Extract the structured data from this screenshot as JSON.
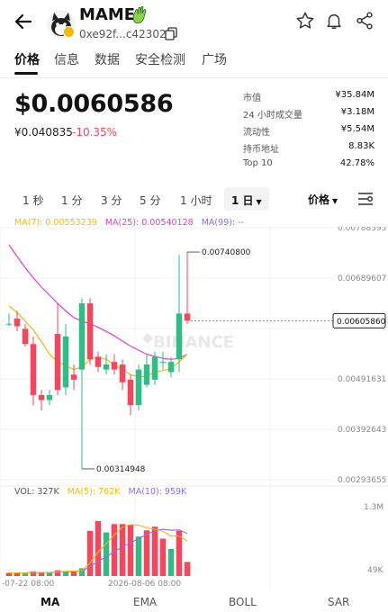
{
  "header": {
    "token_name": "MAME",
    "address": "0xe92f...c42302",
    "icons": [
      "back-arrow-icon",
      "avatar",
      "wave-emoji-icon",
      "copy-icon",
      "star-icon",
      "bell-icon",
      "share-icon"
    ]
  },
  "tabs": [
    {
      "label": "价格",
      "active": true
    },
    {
      "label": "信息",
      "active": false
    },
    {
      "label": "数据",
      "active": false
    },
    {
      "label": "安全检测",
      "active": false
    },
    {
      "label": "广场",
      "active": false
    }
  ],
  "price": {
    "main": "$0.0060586",
    "secondary": "¥0.040835",
    "change": "-10.35%"
  },
  "stats": [
    {
      "label": "市值",
      "value": "¥35.84M"
    },
    {
      "label": "24 小时成交量",
      "value": "¥3.18M"
    },
    {
      "label": "流动性",
      "value": "¥5.54M"
    },
    {
      "label": "持币地址",
      "value": "8.83K"
    },
    {
      "label": "Top 10",
      "value": "42.78%"
    }
  ],
  "intervals": [
    "1 秒",
    "1 分",
    "3 分",
    "5 分",
    "1 小时",
    "1 日"
  ],
  "active_interval": "1 日",
  "price_selector": "价格",
  "ma_legend": {
    "ma7": "MA(7): 0.00553239",
    "ma25": "MA(25): 0.00540128",
    "ma99": "MA(99): --"
  },
  "vol_legend": {
    "vol": "VOL: 327K",
    "ma5": "MA(5): 762K",
    "ma10": "MA(10): 959K"
  },
  "colors": {
    "up": "#2ebd85",
    "down": "#f6465d",
    "ma7": "#f0b90b",
    "ma25": "#e83ad1",
    "ma99": "#8d6ee8"
  },
  "chart_data": {
    "type": "candlestick",
    "y_axis_labels": [
      "0.00788595",
      "0.00689607",
      "0.00590619",
      "0.00491631",
      "0.00392643",
      "0.00293655"
    ],
    "ylim": [
      0.00293655,
      0.00788595
    ],
    "high_marker": "0.00740800",
    "low_marker": "0.00314948",
    "current_price_marker": "0.00605860",
    "x_axis_labels": [
      "-07-22 08:00",
      "2026-08-06 08:00"
    ],
    "watermark": "BINANCE",
    "candles": [
      {
        "o": 0.006,
        "c": 0.006,
        "h": 0.0062,
        "l": 0.00595
      },
      {
        "o": 0.0061,
        "c": 0.00595,
        "h": 0.00625,
        "l": 0.00585
      },
      {
        "o": 0.0059,
        "c": 0.0056,
        "h": 0.006,
        "l": 0.00555
      },
      {
        "o": 0.0056,
        "c": 0.0046,
        "h": 0.00575,
        "l": 0.0044
      },
      {
        "o": 0.0046,
        "c": 0.0045,
        "h": 0.0047,
        "l": 0.0043
      },
      {
        "o": 0.0045,
        "c": 0.0046,
        "h": 0.0047,
        "l": 0.0044
      },
      {
        "o": 0.0058,
        "c": 0.0047,
        "h": 0.0064,
        "l": 0.0046
      },
      {
        "o": 0.00475,
        "c": 0.00575,
        "h": 0.006,
        "l": 0.0046
      },
      {
        "o": 0.005,
        "c": 0.0049,
        "h": 0.0052,
        "l": 0.0047
      },
      {
        "o": 0.0051,
        "c": 0.0064,
        "h": 0.0065,
        "l": 0.00314948
      },
      {
        "o": 0.0064,
        "c": 0.0053,
        "h": 0.0065,
        "l": 0.0052
      },
      {
        "o": 0.00535,
        "c": 0.00515,
        "h": 0.00545,
        "l": 0.00505
      },
      {
        "o": 0.0051,
        "c": 0.0052,
        "h": 0.0054,
        "l": 0.005
      },
      {
        "o": 0.00525,
        "c": 0.0051,
        "h": 0.0054,
        "l": 0.005
      },
      {
        "o": 0.0052,
        "c": 0.00485,
        "h": 0.0053,
        "l": 0.0047
      },
      {
        "o": 0.0049,
        "c": 0.0044,
        "h": 0.005,
        "l": 0.0042
      },
      {
        "o": 0.0044,
        "c": 0.0051,
        "h": 0.0052,
        "l": 0.0043
      },
      {
        "o": 0.0048,
        "c": 0.0052,
        "h": 0.0054,
        "l": 0.00475
      },
      {
        "o": 0.0049,
        "c": 0.00535,
        "h": 0.00545,
        "l": 0.0048
      },
      {
        "o": 0.00525,
        "c": 0.00525,
        "h": 0.00545,
        "l": 0.0051
      },
      {
        "o": 0.00505,
        "c": 0.00525,
        "h": 0.00535,
        "l": 0.00495
      },
      {
        "o": 0.0053,
        "c": 0.0062,
        "h": 0.00735,
        "l": 0.00505
      },
      {
        "o": 0.0062,
        "c": 0.0060586,
        "h": 0.007408,
        "l": 0.006
      }
    ],
    "ma7": [
      0.00635,
      0.00622,
      0.00605,
      0.00588,
      0.00565,
      0.0054,
      0.00525,
      0.00518,
      0.0051,
      0.00515,
      0.0053,
      0.00535,
      0.0053,
      0.0052,
      0.0051,
      0.005,
      0.00495,
      0.00498,
      0.00505,
      0.00508,
      0.00512,
      0.00525,
      0.0054
    ],
    "ma25": [
      0.00755,
      0.00732,
      0.0071,
      0.0069,
      0.00672,
      0.00656,
      0.0064,
      0.00625,
      0.00612,
      0.00605,
      0.006,
      0.00593,
      0.00585,
      0.00576,
      0.00566,
      0.00556,
      0.00548,
      0.0054,
      0.00536,
      0.00532,
      0.0053,
      0.00532,
      0.0054
    ],
    "volume": {
      "ylim_label_top": "1.3M",
      "ylim_label_bottom": "49K",
      "max": 1300000,
      "bars": [
        {
          "v": 60000,
          "up": false
        },
        {
          "v": 60000,
          "up": false
        },
        {
          "v": 50000,
          "up": true
        },
        {
          "v": 90000,
          "up": false
        },
        {
          "v": 70000,
          "up": false
        },
        {
          "v": 70000,
          "up": true
        },
        {
          "v": 110000,
          "up": false
        },
        {
          "v": 90000,
          "up": true
        },
        {
          "v": 80000,
          "up": false
        },
        {
          "v": 150000,
          "up": true
        },
        {
          "v": 870000,
          "up": false
        },
        {
          "v": 1060000,
          "up": false
        },
        {
          "v": 840000,
          "up": true
        },
        {
          "v": 1000000,
          "up": false
        },
        {
          "v": 1000000,
          "up": false
        },
        {
          "v": 990000,
          "up": false
        },
        {
          "v": 760000,
          "up": true
        },
        {
          "v": 880000,
          "up": false
        },
        {
          "v": 950000,
          "up": false
        },
        {
          "v": 720000,
          "up": false
        },
        {
          "v": 520000,
          "up": true
        },
        {
          "v": 870000,
          "up": false
        },
        {
          "v": 270000,
          "up": false
        }
      ],
      "ma5": [
        60000,
        60000,
        60000,
        70000,
        70000,
        70000,
        80000,
        90000,
        95000,
        100000,
        250000,
        460000,
        620000,
        790000,
        940000,
        990000,
        980000,
        930000,
        900000,
        860000,
        770000,
        770000,
        680000
      ],
      "ma10": [
        60000,
        60000,
        60000,
        65000,
        68000,
        70000,
        75000,
        82000,
        88000,
        95000,
        180000,
        280000,
        370000,
        470000,
        560000,
        640000,
        720000,
        800000,
        870000,
        900000,
        880000,
        890000,
        820000
      ]
    }
  },
  "bottom_tabs": [
    {
      "label": "MA",
      "active": true
    },
    {
      "label": "EMA",
      "active": false
    },
    {
      "label": "BOLL",
      "active": false
    },
    {
      "label": "SAR",
      "active": false
    }
  ]
}
